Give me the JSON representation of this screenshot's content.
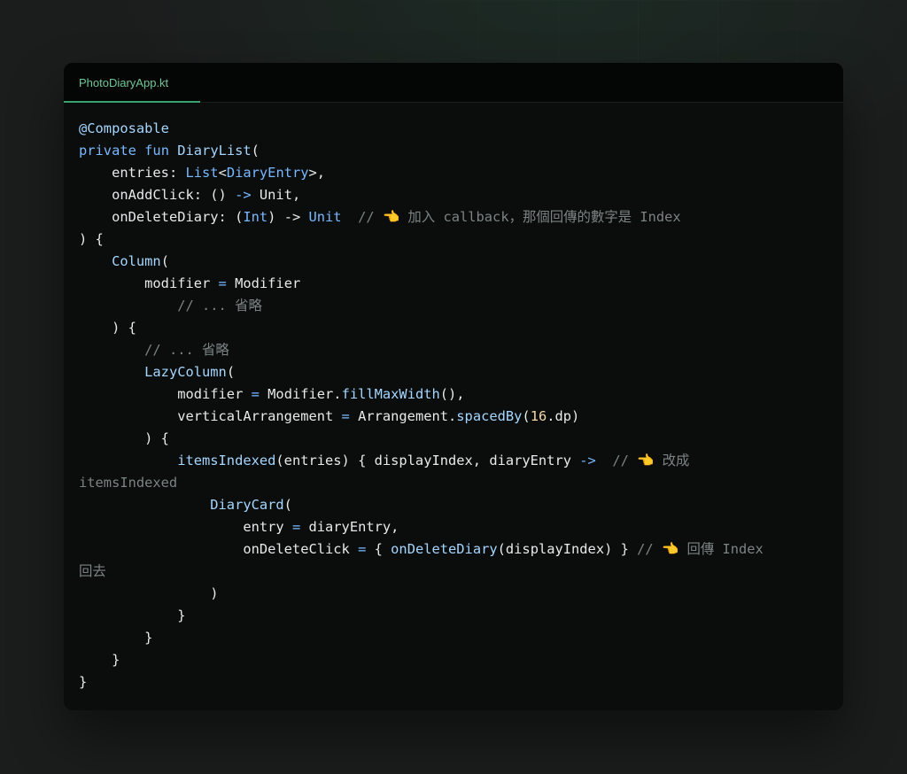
{
  "tab": {
    "filename": "PhotoDiaryApp.kt"
  },
  "code": {
    "l1_annotation": "@Composable",
    "l2_private": "private",
    "l2_fun": "fun",
    "l2_name": "DiaryList",
    "l2_paren": "(",
    "l3_param": "entries: ",
    "l3_type": "List",
    "l3_lt": "<",
    "l3_arg": "DiaryEntry",
    "l3_end": ">,",
    "l4_param": "onAddClick: () ",
    "l4_arrow": "->",
    "l4_end": " Unit,",
    "l5_param": "onDeleteDiary: (",
    "l5_int": "Int",
    "l5_mid": ") -> ",
    "l5_unit": "Unit",
    "l5_comment_slashes": "//",
    "l5_emoji": "👈",
    "l5_comment": "加入 callback，那個回傳的數字是 Index",
    "l6": ") {",
    "l7_fn": "Column",
    "l7_paren": "(",
    "l8_a": "modifier ",
    "l8_eq": "=",
    "l8_b": " Modifier",
    "l9_comment": "// ... 省略",
    "l10": ") {",
    "l11_comment": "// ... 省略",
    "l12_fn": "LazyColumn",
    "l12_paren": "(",
    "l13_a": "modifier ",
    "l13_eq": "=",
    "l13_b": " Modifier.",
    "l13_fn": "fillMaxWidth",
    "l13_end": "(),",
    "l14_a": "verticalArrangement ",
    "l14_eq": "=",
    "l14_b": " Arrangement.",
    "l14_fn": "spacedBy",
    "l14_p": "(",
    "l14_num": "16",
    "l14_end": ".dp)",
    "l15": ") {",
    "l16_fn": "itemsIndexed",
    "l16_a": "(entries) { displayIndex, diaryEntry ",
    "l16_arrow": "->",
    "l16_comment_slashes": "//",
    "l16_emoji": "👈",
    "l16_comment": "改成",
    "l17_comment_wrap": "itemsIndexed",
    "l18_fn": "DiaryCard",
    "l18_paren": "(",
    "l19_a": "entry ",
    "l19_eq": "=",
    "l19_b": " diaryEntry,",
    "l20_a": "onDeleteClick ",
    "l20_eq": "=",
    "l20_b": " { ",
    "l20_fn": "onDeleteDiary",
    "l20_c": "(displayIndex) } ",
    "l20_comment_slashes": "//",
    "l20_emoji": "👈",
    "l20_comment": "回傳 Index",
    "l21_comment_wrap": "回去",
    "l22": ")",
    "l23": "}",
    "l24": "}",
    "l25": "}",
    "l26": "}"
  }
}
